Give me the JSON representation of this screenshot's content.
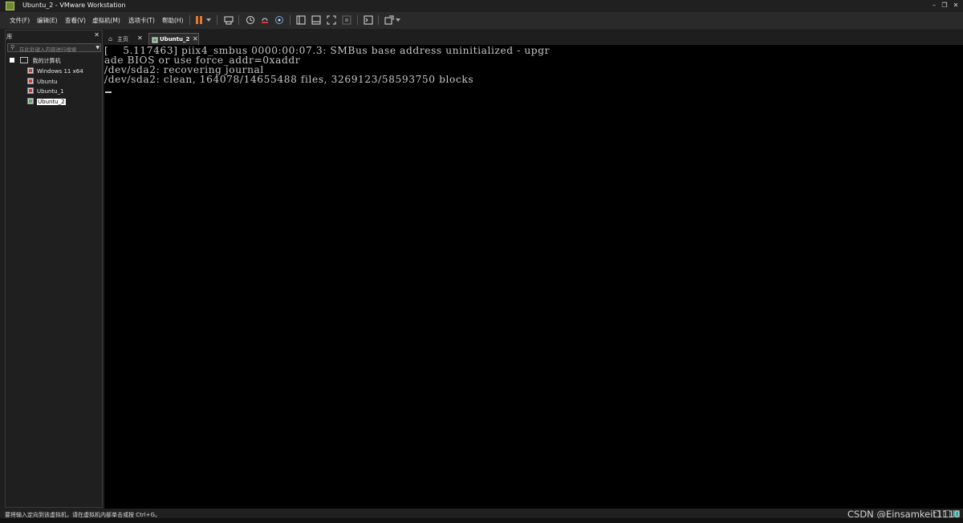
{
  "window": {
    "title": "Ubuntu_2  - VMware Workstation"
  },
  "menu": {
    "items": [
      "文件(F)",
      "编辑(E)",
      "查看(V)",
      "虚拟机(M)",
      "选项卡(T)",
      "帮助(H)"
    ]
  },
  "toolbar": {
    "icons": [
      "pause-icon",
      "dropdown-icon",
      "send-keys-icon",
      "snapshot-icon",
      "revert-snapshot-icon",
      "snapshot-manager-icon",
      "library-view-icon",
      "thumbnail-view-icon",
      "fullscreen-icon",
      "unity-icon",
      "console-icon",
      "stretch-icon"
    ]
  },
  "library": {
    "header": "库",
    "search_placeholder": "在此处键入内容进行搜索",
    "root": "我的计算机",
    "vms": [
      {
        "name": "Windows 11 x64",
        "state": "off"
      },
      {
        "name": "Ubuntu",
        "state": "off"
      },
      {
        "name": "Ubuntu_1",
        "state": "off"
      },
      {
        "name": "Ubuntu_2",
        "state": "running",
        "selected": true
      }
    ]
  },
  "tabs": [
    {
      "label": "主页",
      "active": false
    },
    {
      "label": "Ubuntu_2",
      "active": true
    }
  ],
  "console": {
    "lines": [
      "[    5.117463] piix4_smbus 0000:00:07.3: SMBus base address uninitialized - upgr",
      "ade BIOS or use force_addr=0xaddr",
      "/dev/sda2: recovering journal",
      "/dev/sda2: clean, 164078/14655488 files, 3269123/58593750 blocks"
    ]
  },
  "status": {
    "message": "要将输入定向到该虚拟机，请在虚拟机内部单击或按 Ctrl+G。"
  },
  "watermark": "CSDN @Einsamkeit1110",
  "colors": {
    "pause_accent": "#e8772e",
    "console_bg": "#000000",
    "console_text": "#c8c8c8"
  }
}
